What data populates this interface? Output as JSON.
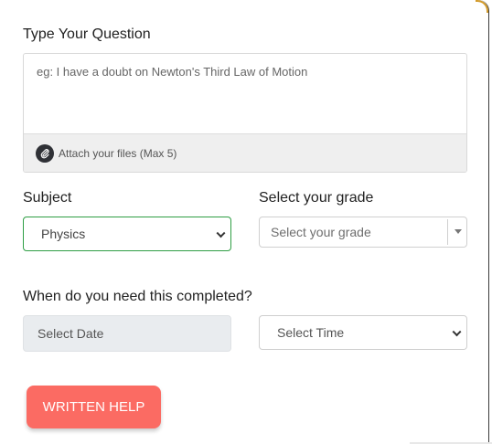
{
  "question": {
    "label": "Type Your Question",
    "placeholder": "eg: I have a doubt on Newton's Third Law of Motion",
    "attach_label": "Attach your files (Max 5)",
    "attach_icon": "paperclip-icon"
  },
  "subject": {
    "label": "Subject",
    "selected": "Physics"
  },
  "grade": {
    "label": "Select your grade",
    "placeholder": "Select your grade"
  },
  "completion": {
    "label": "When do you need this completed?",
    "date_placeholder": "Select Date",
    "time_selected": "Select Time"
  },
  "submit": {
    "label": "WRITTEN HELP"
  },
  "colors": {
    "accent_button": "#fb6b63",
    "subject_border": "#2e9e44",
    "corner_accent": "#d39b2a"
  }
}
